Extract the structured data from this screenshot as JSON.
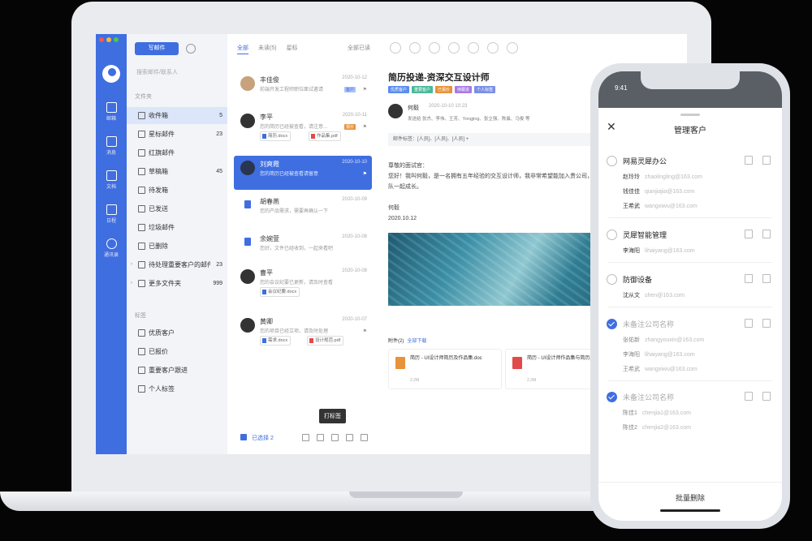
{
  "nav": {
    "items": [
      {
        "label": "邮箱"
      },
      {
        "label": "消息"
      },
      {
        "label": "文档"
      },
      {
        "label": "日程"
      },
      {
        "label": "通讯录"
      }
    ]
  },
  "folders": {
    "compose_label": "写邮件",
    "search_placeholder": "搜索邮件/联系人",
    "section_mail": "文件夹",
    "items": [
      {
        "label": "收件箱",
        "count": "5"
      },
      {
        "label": "星标邮件",
        "count": "23"
      },
      {
        "label": "红旗邮件",
        "count": ""
      },
      {
        "label": "草稿箱",
        "count": "45"
      },
      {
        "label": "待发箱",
        "count": ""
      },
      {
        "label": "已发送",
        "count": ""
      },
      {
        "label": "垃圾邮件",
        "count": ""
      },
      {
        "label": "已删除",
        "count": ""
      },
      {
        "label": "待处理重要客户的邮件",
        "count": "23"
      },
      {
        "label": "更多文件夹",
        "count": "999"
      }
    ],
    "section_tags": "标签",
    "tags": [
      {
        "label": "优质客户"
      },
      {
        "label": "已报价"
      },
      {
        "label": "重要客户跟进"
      },
      {
        "label": "个人标签"
      }
    ]
  },
  "list": {
    "tabs": [
      "全部",
      "未读(5)",
      "星标"
    ],
    "mark_read": "全部已读",
    "items": [
      {
        "name": "丰佳俊",
        "time": "2020-10-12",
        "summary": "前端开发工程师职位面试邀请",
        "tag": "客户",
        "att1": "",
        "att2": ""
      },
      {
        "name": "李平",
        "time": "2020-10-11",
        "summary": "您的简历已经被查看，请注意...",
        "tag": "报价",
        "att1": "简历.docx",
        "att2": "作品集.pdf"
      },
      {
        "name": "刘爽霞",
        "time": "2020-10-10",
        "summary": "您的简历已经被查看请留意",
        "tag": "",
        "att1": "",
        "att2": ""
      },
      {
        "name": "胡春燕",
        "time": "2020-10-09",
        "summary": "您的产品需求，需要再确认一下",
        "tag": "",
        "att1": "",
        "att2": ""
      },
      {
        "name": "余婉萱",
        "time": "2020-10-08",
        "summary": "您好，文件已经收到，一起来看吧",
        "tag": "",
        "att1": "",
        "att2": ""
      },
      {
        "name": "曹平",
        "time": "2020-10-08",
        "summary": "您的会议纪要已更新，请及时查看",
        "tag": "",
        "att1": "会议纪要.docx",
        "att2": ""
      },
      {
        "name": "黄卿",
        "time": "2020-10-07",
        "summary": "您的项目已经立项，请及时处理",
        "tag": "",
        "att1": "需求.docx",
        "att2": "设计规范.pdf"
      }
    ],
    "selected_count": "已选择 2",
    "tooltip": "打标签"
  },
  "reader": {
    "subject": "简历投递-资深交互设计师",
    "tags": [
      {
        "label": "优质客户",
        "color": "#5b8def"
      },
      {
        "label": "重要客户",
        "color": "#4cb89a"
      },
      {
        "label": "已报价",
        "color": "#e8923a"
      },
      {
        "label": "待跟进",
        "color": "#a77be6"
      },
      {
        "label": "个人标签",
        "color": "#7b8fe6"
      }
    ],
    "sender": "何毅",
    "time": "2020-10-10 10:23",
    "recipients": "发送给 张杰、李伟、王芳、Yongjing、张立强、陈晨、马俊 等",
    "tagbar": "邮件标签：[人员]、[人员]、[人员] +",
    "greeting": "尊敬的面试官：",
    "body": "您好！我叫何毅，是一名拥有五年经验的交互设计师，我非常希望能加入贵公司，在这里发挥自己的设计能力，与团队一起成长。",
    "signature": "何毅",
    "date": "2020.10.12",
    "attachments_title": "附件(2)",
    "attachments_link": "全部下载",
    "attachments": [
      {
        "name": "简历 - UI设计师简历及作品集.doc",
        "size": "2.2M",
        "color": "#e8923a"
      },
      {
        "name": "简历 - UI设计师作品集与简历2.doc",
        "size": "2.2M",
        "color": "#e24a4a"
      }
    ]
  },
  "phone": {
    "time": "9:41",
    "title": "管理客户",
    "groups": [
      {
        "name": "网易灵犀办公",
        "checked": false,
        "dim": false,
        "contacts": [
          {
            "name": "赵玲玲",
            "email": "zhaolingling@163.com"
          },
          {
            "name": "钱佳佳",
            "email": "qianjiajia@163.com"
          },
          {
            "name": "王希武",
            "email": "wangxiwu@163.com"
          }
        ]
      },
      {
        "name": "灵犀智能管理",
        "checked": false,
        "dim": false,
        "contacts": [
          {
            "name": "李海阳",
            "email": "lihaiyang@163.com"
          }
        ]
      },
      {
        "name": "防御设备",
        "checked": false,
        "dim": false,
        "contacts": [
          {
            "name": "沈从文",
            "email": "shen@163.com"
          }
        ]
      },
      {
        "name": "未备注公司名称",
        "checked": true,
        "dim": true,
        "contacts": [
          {
            "name": "张佑新",
            "email": "zhangyouxin@163.com"
          },
          {
            "name": "李海阳",
            "email": "lihaiyang@163.com"
          },
          {
            "name": "王希武",
            "email": "wangxiwu@163.com"
          }
        ]
      },
      {
        "name": "未备注公司名称",
        "checked": true,
        "dim": true,
        "contacts": [
          {
            "name": "陈佳1",
            "email": "chenjia1@163.com"
          },
          {
            "name": "陈佳2",
            "email": "chenjia2@163.com"
          }
        ]
      }
    ],
    "bulk_delete": "批量删除"
  }
}
